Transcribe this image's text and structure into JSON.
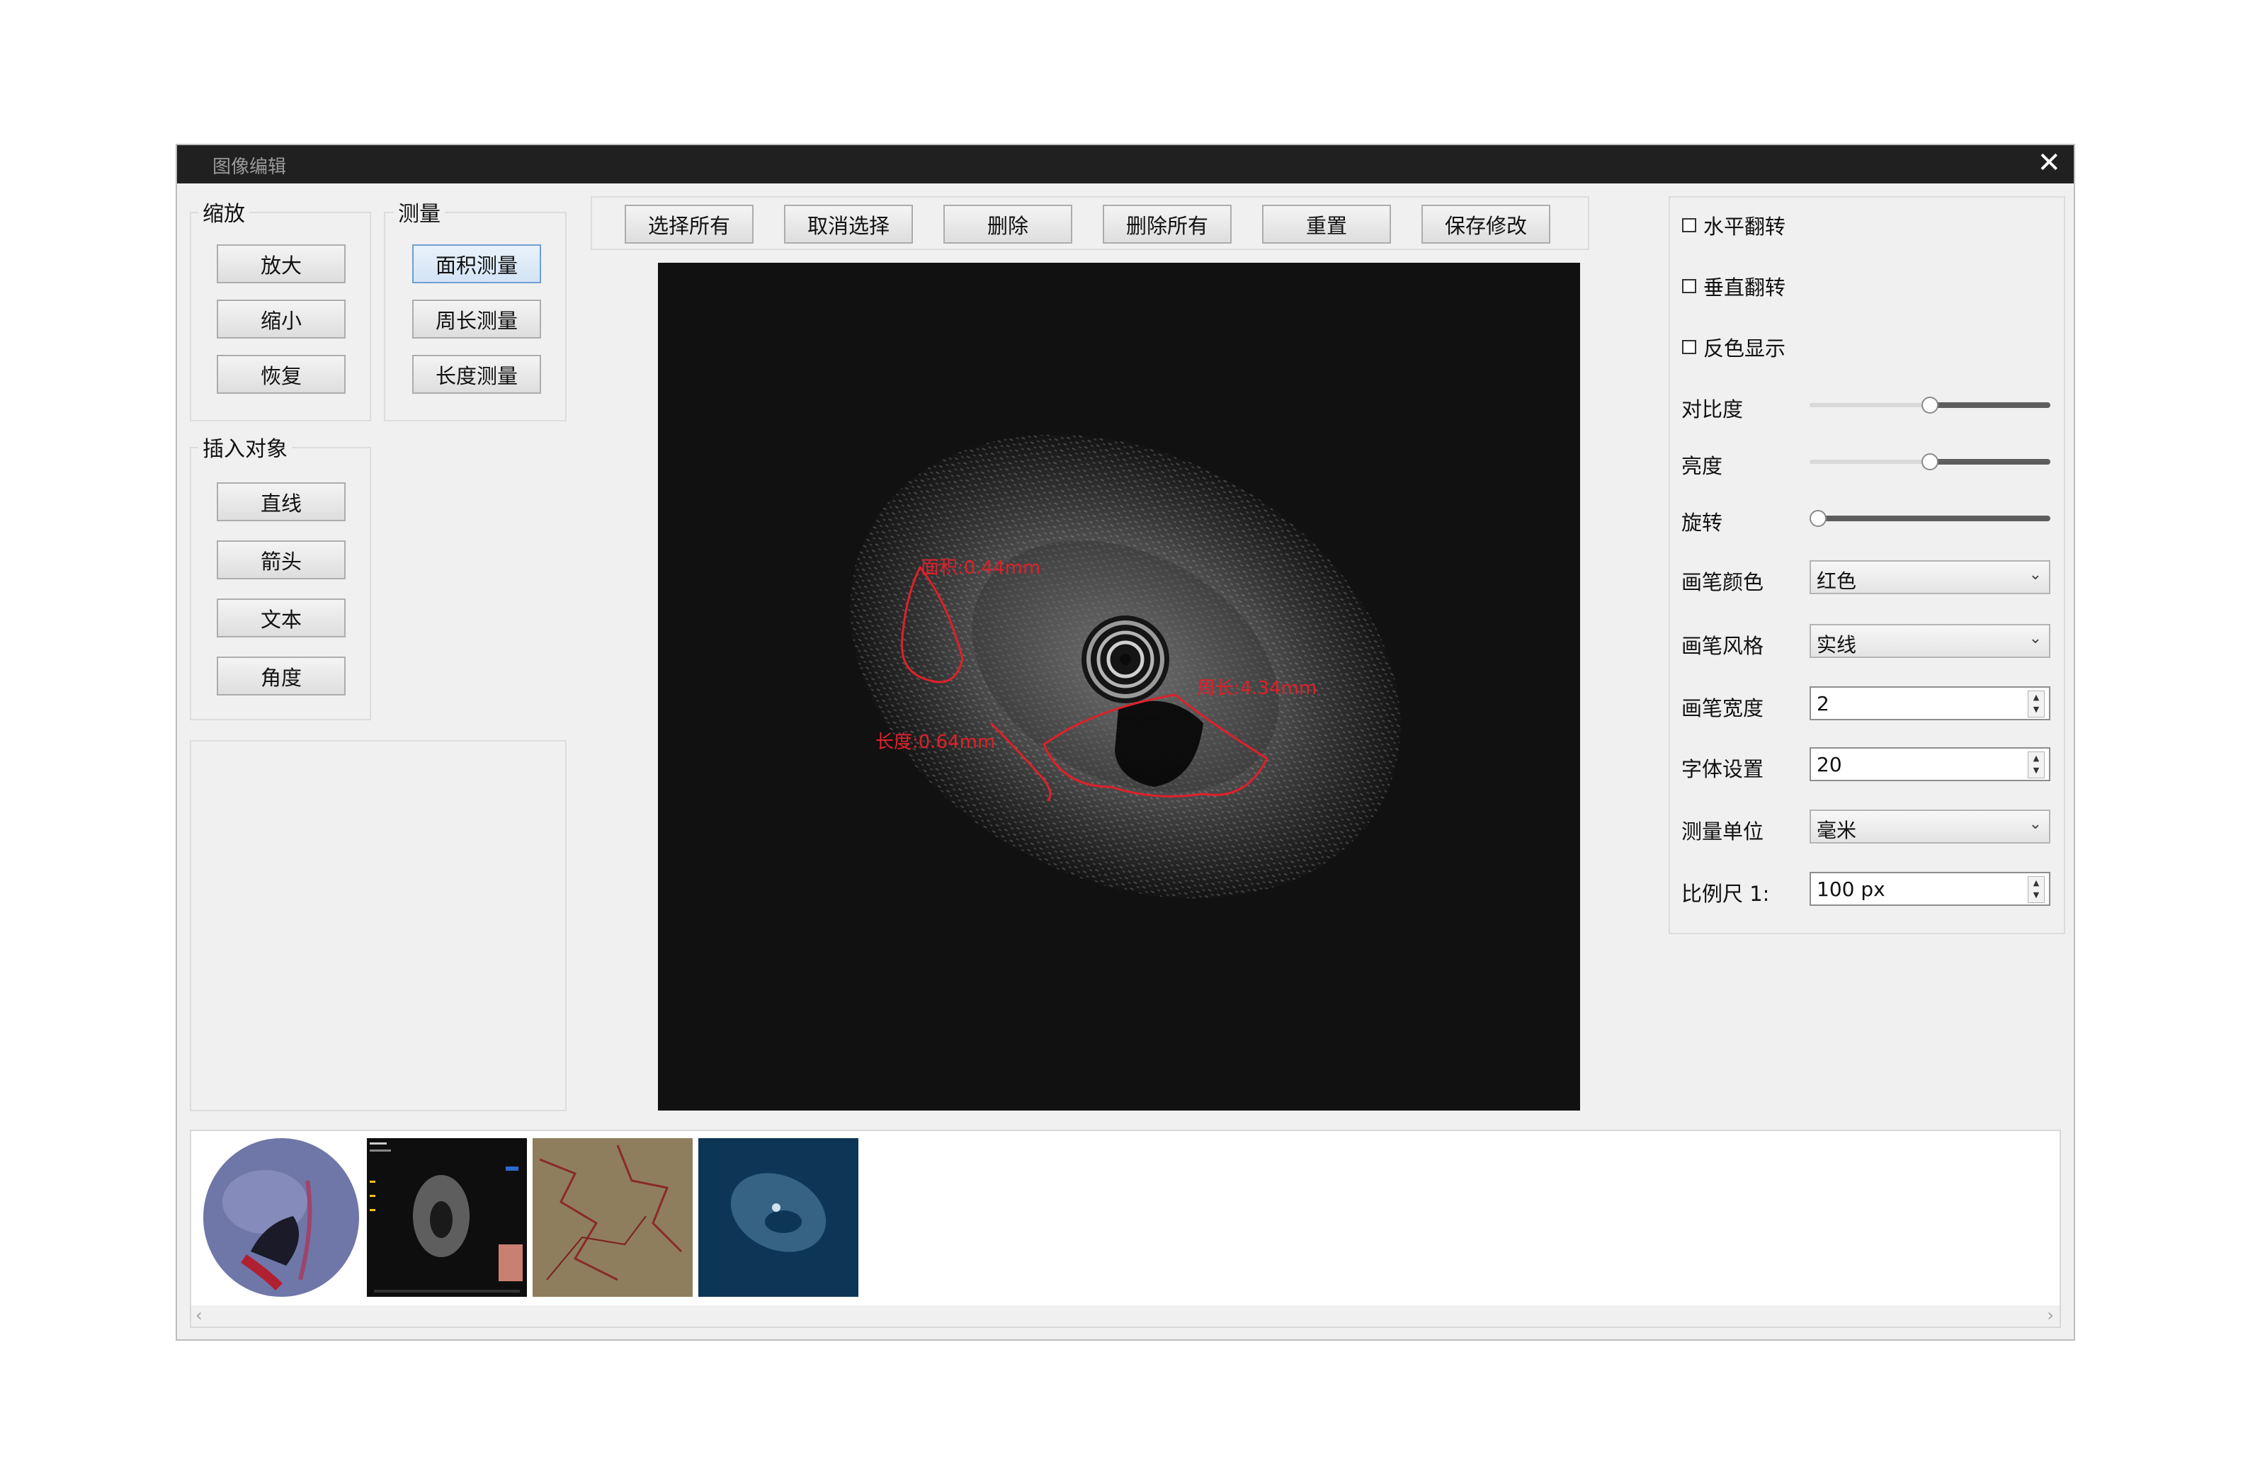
{
  "window": {
    "title": "图像编辑"
  },
  "zoom_group": {
    "label": "缩放",
    "buttons": [
      "放大",
      "缩小",
      "恢复"
    ]
  },
  "measure_group": {
    "label": "测量",
    "buttons": [
      "面积测量",
      "周长测量",
      "长度测量"
    ],
    "selected": "面积测量"
  },
  "insert_group": {
    "label": "插入对象",
    "buttons": [
      "直线",
      "箭头",
      "文本",
      "角度"
    ]
  },
  "toolbar": {
    "buttons": [
      "选择所有",
      "取消选择",
      "删除",
      "删除所有",
      "重置",
      "保存修改"
    ]
  },
  "annotations": {
    "area": "面积:0.44mm",
    "perimeter": "周长:4.34mm",
    "length": "长度:0.64mm",
    "color": "#e0202a"
  },
  "properties": {
    "checkboxes": [
      {
        "label": "水平翻转",
        "checked": false
      },
      {
        "label": "垂直翻转",
        "checked": false
      },
      {
        "label": "反色显示",
        "checked": false
      }
    ],
    "contrast": {
      "label": "对比度",
      "value": 0.5
    },
    "brightness": {
      "label": "亮度",
      "value": 0.5
    },
    "rotation": {
      "label": "旋转",
      "value": 0.0
    },
    "pen_color": {
      "label": "画笔颜色",
      "value": "红色"
    },
    "pen_style": {
      "label": "画笔风格",
      "value": "实线"
    },
    "pen_width": {
      "label": "画笔宽度",
      "value": "2"
    },
    "font_size": {
      "label": "字体设置",
      "value": "20"
    },
    "unit": {
      "label": "测量单位",
      "value": "毫米"
    },
    "scale": {
      "label": "比例尺 1:",
      "value": "100 px"
    }
  },
  "thumbnails": [
    "endoscopy-photo",
    "ultrasound-screen",
    "mucosa-closeup",
    "ultrasound-blue"
  ],
  "icons": {
    "close": "close-icon",
    "scroll_left": "chevron-left-icon",
    "scroll_right": "chevron-right-icon",
    "dropdown": "chevron-down-icon"
  }
}
